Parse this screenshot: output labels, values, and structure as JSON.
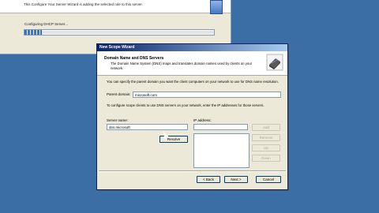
{
  "background_wizard": {
    "description": "This Configure Your Server Wizard is adding the selected role to this server.",
    "progress_label": "Configuring DHCP Server...",
    "progress_value": 0.09
  },
  "dialog": {
    "title": "New Scope Wizard",
    "heading": "Domain Name and DNS Servers",
    "subheading": "The Domain Name System (DNS) maps and translates domain names used by clients on your network.",
    "intro_text": "You can specify the parent domain you want the client computers on your network to use for DNS name resolution.",
    "parent_domain": {
      "label": "Parent domain:",
      "value": "microsoft.com"
    },
    "dns_text": "To configure scope clients to use DNS servers on your network, enter the IP addresses for those servers.",
    "server_name": {
      "label": "Server name:",
      "value": "dns.microsoft"
    },
    "ip_address": {
      "label": "IP address:"
    },
    "resolve_label": "Resolve",
    "side_buttons": [
      "Add",
      "Remove",
      "Up",
      "Down"
    ],
    "footer": {
      "back_label": "< Back",
      "next_label": "Next >",
      "cancel_label": "Cancel"
    }
  }
}
